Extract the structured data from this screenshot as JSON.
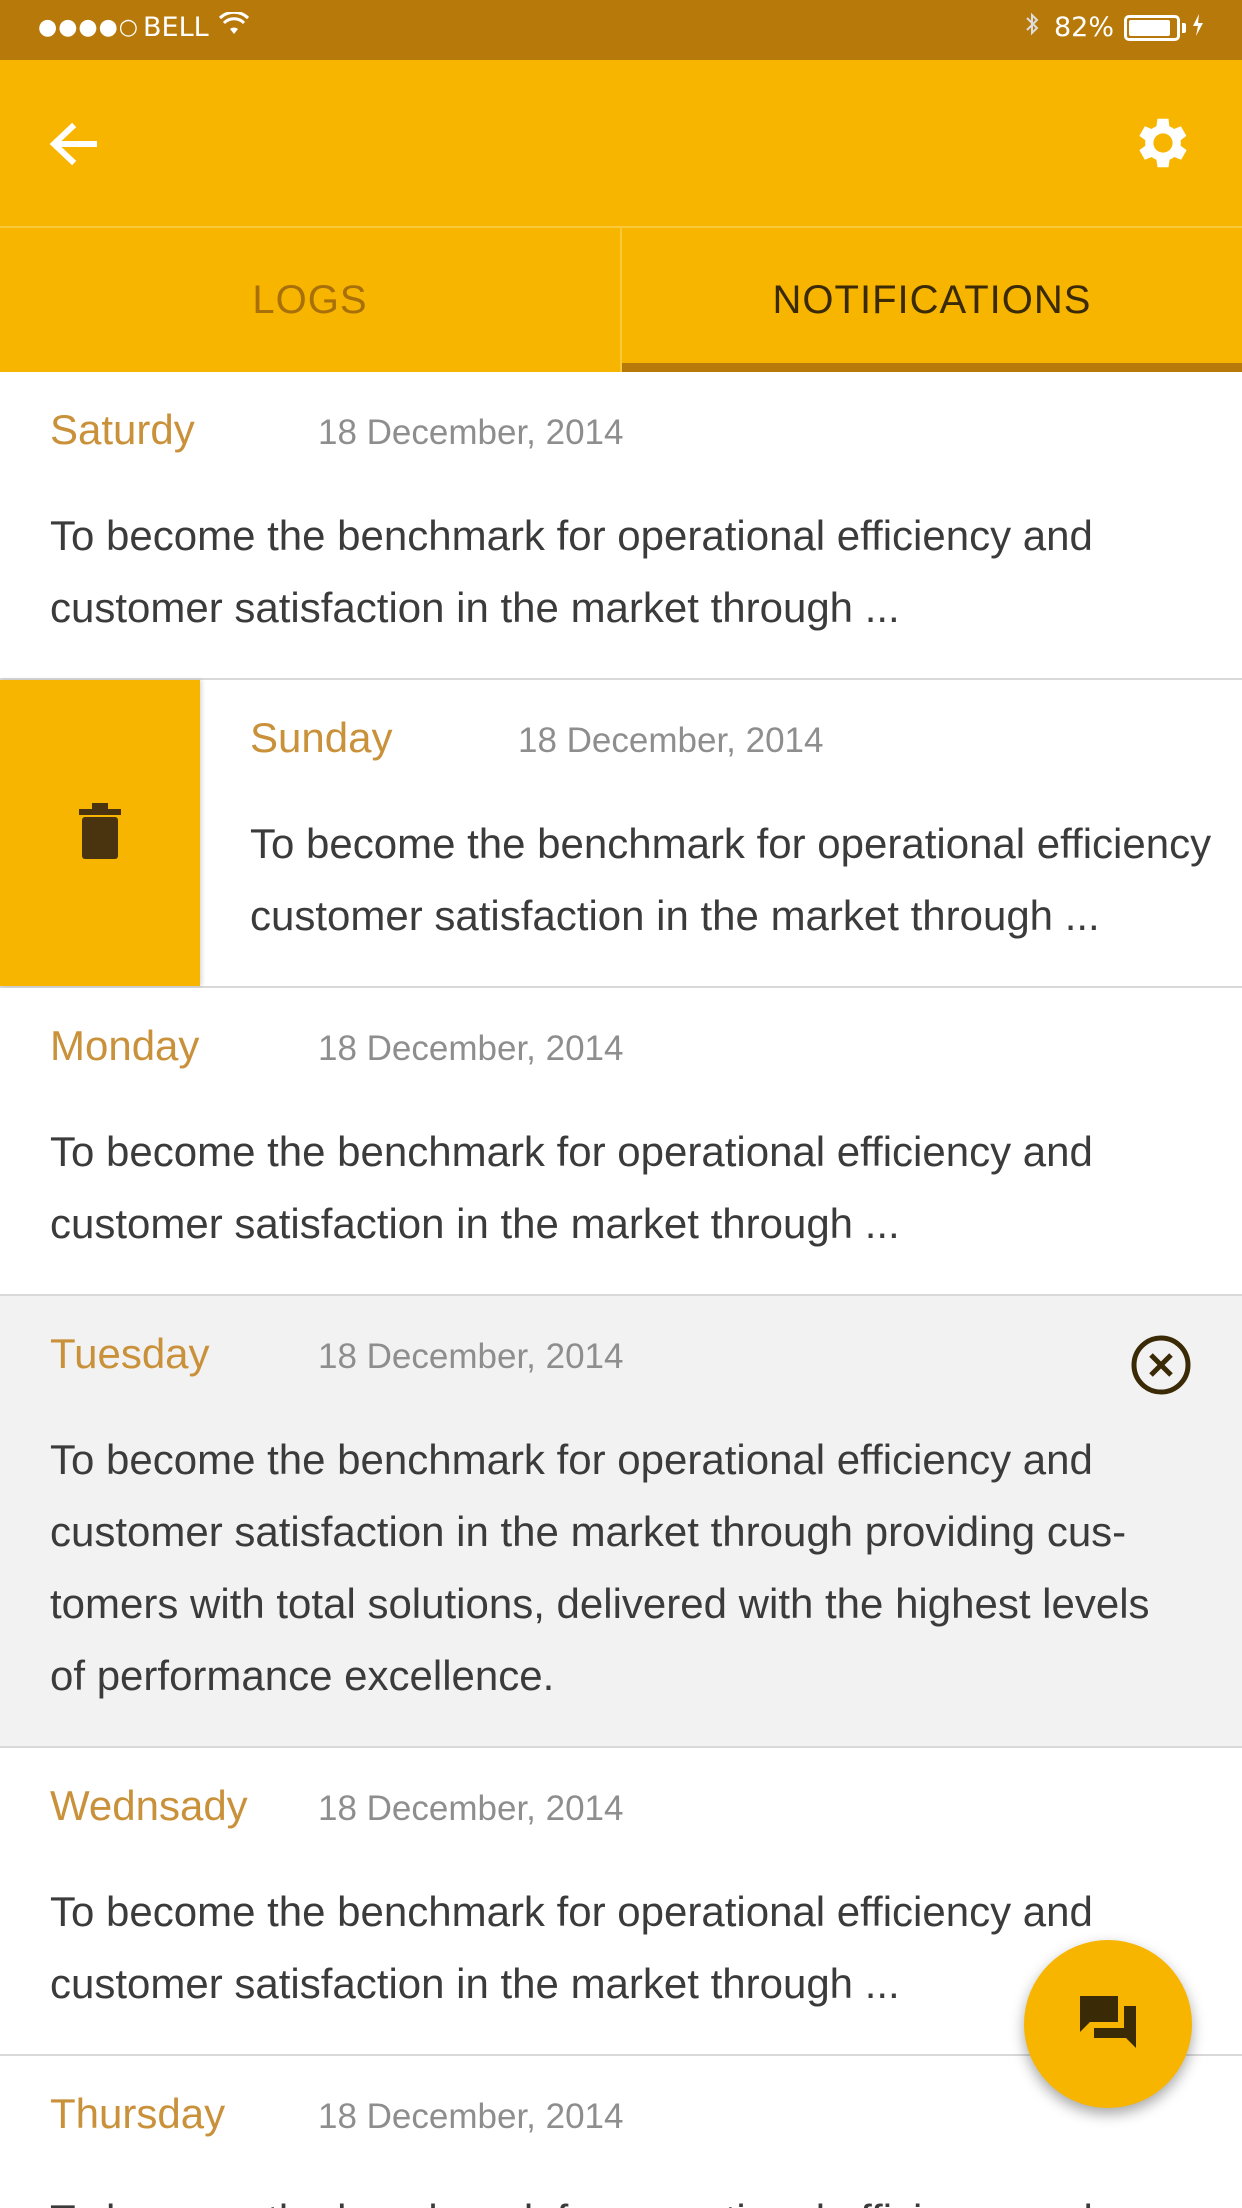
{
  "status_bar": {
    "signal": "●●●●○",
    "carrier": "BELL",
    "battery_percent": "82%"
  },
  "app_bar": {
    "back_icon": "arrow-left-icon",
    "settings_icon": "gear-icon"
  },
  "tabs": [
    {
      "label": "LOGS",
      "active": false
    },
    {
      "label": "NOTIFICATIONS",
      "active": true
    }
  ],
  "notifications": [
    {
      "day": "Saturdy",
      "date": "18 December, 2014",
      "text": "To become the benchmark for operational efficiency and customer satisfaction in the market through ..."
    },
    {
      "day": "Sunday",
      "date": "18 December, 2014",
      "text_line1": "To become the benchmark for operational efficiency",
      "text_line2": "customer satisfaction in the market through ...",
      "swiped": true,
      "action_icon": "trash-icon"
    },
    {
      "day": "Monday",
      "date": "18 December, 2014",
      "text": "To become the benchmark for operational efficiency and customer satisfaction in the market through ..."
    },
    {
      "day": "Tuesday",
      "date": "18 December, 2014",
      "text": "To become the benchmark for operational efficiency and customer satisfaction in the market through providing cus-tomers with total solutions, delivered with the highest levels of performance excellence.",
      "expanded": true,
      "close_icon": "close-circle-icon"
    },
    {
      "day": "Wednsady",
      "date": "18 December, 2014",
      "text": "To become the benchmark for operational efficiency and customer satisfaction in the market through ..."
    },
    {
      "day": "Thursday",
      "date": "18 December, 2014",
      "text": "To become the benchmark for operational efficiency and"
    }
  ],
  "fab": {
    "icon": "chat-icon"
  },
  "colors": {
    "primary": "#F7B500",
    "dark": "#B8790B",
    "day_text": "#C9913A"
  }
}
